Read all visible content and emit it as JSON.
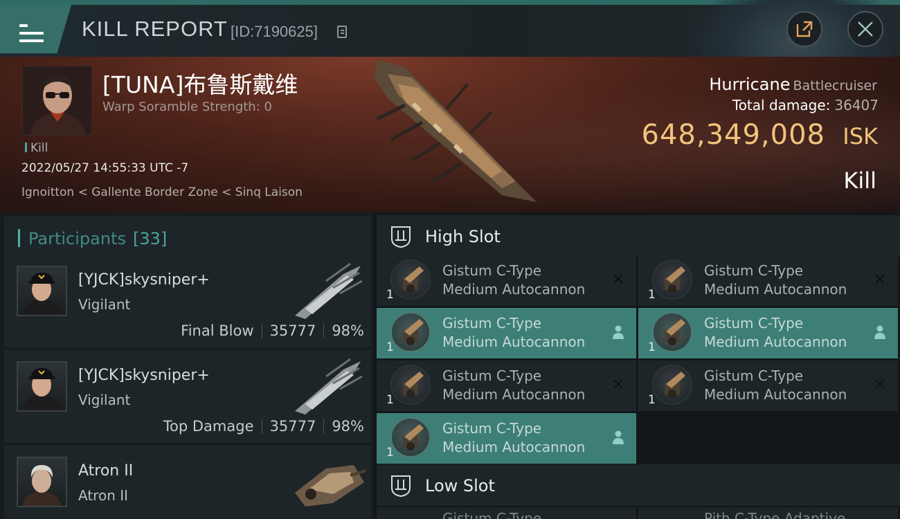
{
  "header": {
    "title": "KILL REPORT",
    "report_id": "[ID:7190625]"
  },
  "victim": {
    "name": "[TUNA]布鲁斯戴维",
    "warp_scramble": "Warp Soramble Strength: 0",
    "tag": "Kill",
    "datetime": "2022/05/27 14:55:33 UTC -7",
    "location": "Ignoitton < Gallente Border Zone < Sinq Laison",
    "ship_name": "Hurricane",
    "ship_class": "Battlecruiser",
    "total_damage_label": "Total damage:",
    "total_damage": "36407",
    "isk_value": "648,349,008",
    "isk_unit": "ISK",
    "result": "Kill"
  },
  "participants": {
    "label": "Participants",
    "count": "[33]",
    "rows": [
      {
        "name": "[YJCK]skysniper+",
        "ship": "Vigilant",
        "role": "Final Blow",
        "damage": "35777",
        "percent": "98%"
      },
      {
        "name": "[YJCK]skysniper+",
        "ship": "Vigilant",
        "role": "Top Damage",
        "damage": "35777",
        "percent": "98%"
      },
      {
        "name": "Atron II",
        "ship": "Atron II"
      }
    ]
  },
  "fitting": {
    "high_slot": {
      "title": "High Slot",
      "modules": [
        {
          "line1": "Gistum C-Type",
          "line2": "Medium Autocannon",
          "qty": "1",
          "status": "destroyed"
        },
        {
          "line1": "Gistum C-Type",
          "line2": "Medium Autocannon",
          "qty": "1",
          "status": "destroyed"
        },
        {
          "line1": "Gistum C-Type",
          "line2": "Medium Autocannon",
          "qty": "1",
          "status": "dropped"
        },
        {
          "line1": "Gistum C-Type",
          "line2": "Medium Autocannon",
          "qty": "1",
          "status": "dropped"
        },
        {
          "line1": "Gistum C-Type",
          "line2": "Medium Autocannon",
          "qty": "1",
          "status": "destroyed"
        },
        {
          "line1": "Gistum C-Type",
          "line2": "Medium Autocannon",
          "qty": "1",
          "status": "destroyed"
        },
        {
          "line1": "Gistum C-Type",
          "line2": "Medium Autocannon",
          "qty": "1",
          "status": "dropped"
        }
      ]
    },
    "low_slot": {
      "title": "Low Slot",
      "partial_left": "Gistum C-Type",
      "partial_right": "Pith C-Type Adaptive"
    }
  },
  "colors": {
    "accent_teal": "#3d7f76",
    "isk_gold": "#f1c47c",
    "participants_count": "#4aa79a"
  },
  "icons": {
    "menu": "hamburger-icon",
    "copy": "copy-icon",
    "share": "share-external-icon",
    "close": "close-icon",
    "slot": "slot-emblem-icon",
    "destroyed": "x-mark-icon",
    "dropped": "person-icon"
  }
}
